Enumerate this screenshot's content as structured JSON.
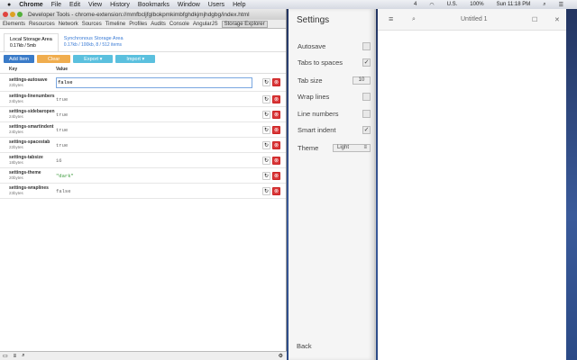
{
  "menubar": {
    "items": [
      "Chrome",
      "File",
      "Edit",
      "View",
      "History",
      "Bookmarks",
      "Window",
      "Users",
      "Help"
    ],
    "status": [
      "4",
      "U.S.",
      "100%",
      "Sun 11:18 PM"
    ]
  },
  "devtools": {
    "title": "Developer Tools - chrome-extension://mmfbcljfglbokpmkimbfghdkjmjhdgbg/index.html",
    "tabs": [
      "Elements",
      "Resources",
      "Network",
      "Sources",
      "Timeline",
      "Profiles",
      "Audits",
      "Console",
      "AngularJS",
      "Storage Explorer"
    ],
    "areas": [
      {
        "title": "Local Storage Area",
        "sub": "0.17kb / 5mb"
      },
      {
        "title": "Synchronous Storage Area",
        "sub": "0.17kb / 100kb, 8 / 512 items"
      }
    ],
    "buttons": {
      "add": "Add Item",
      "clear": "Clear",
      "export": "Export ▾",
      "import": "Import ▾"
    },
    "colors": {
      "add": "#3a7bc8",
      "clear": "#f0ad4e",
      "export": "#5bc0de",
      "delete": "#d9383a"
    },
    "headers": {
      "key": "Key",
      "value": "Value"
    },
    "rows": [
      {
        "key": "settings-autosave",
        "size": "22bytes",
        "value": "false"
      },
      {
        "key": "settings-linenumbers",
        "size": "24bytes",
        "value": "true"
      },
      {
        "key": "settings-sidebaropen",
        "size": "24bytes",
        "value": "true"
      },
      {
        "key": "settings-smartindent",
        "size": "24bytes",
        "value": "true"
      },
      {
        "key": "settings-spacestab",
        "size": "22bytes",
        "value": "true"
      },
      {
        "key": "settings-tabsize",
        "size": "18bytes",
        "value": "16"
      },
      {
        "key": "settings-theme",
        "size": "20bytes",
        "value": "\"dark\""
      },
      {
        "key": "settings-wraplines",
        "size": "23bytes",
        "value": "false"
      }
    ]
  },
  "settings": {
    "title": "Settings",
    "autosave": "Autosave",
    "tabs_to_spaces": "Tabs to spaces",
    "tab_size": "Tab size",
    "tab_size_value": "10",
    "wrap": "Wrap lines",
    "line_numbers": "Line numbers",
    "smart_indent": "Smart indent",
    "theme": "Theme",
    "theme_value": "Light",
    "back": "Back",
    "checked": {
      "autosave": false,
      "tabs": true,
      "wrap": false,
      "lines": false,
      "smart": true
    }
  },
  "editor": {
    "title": "Untitled 1"
  }
}
